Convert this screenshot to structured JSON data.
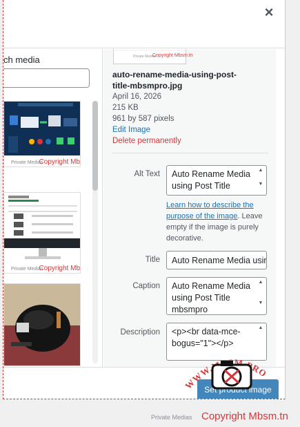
{
  "modal": {
    "close_label": "×"
  },
  "library": {
    "search_label": "ch media",
    "thumbnails": [
      {
        "type": "infographic",
        "watermark": "Private Medias",
        "copyright": "Copyright Mb"
      },
      {
        "type": "screenshot",
        "watermark": "Private Medias",
        "copyright": "Copyright Mb"
      },
      {
        "type": "photo"
      }
    ]
  },
  "details": {
    "filename": "auto-rename-media-using-post-title-mbsmpro.jpg",
    "date": "April 16, 2026",
    "size": "215 KB",
    "dimensions": "961 by 587 pixels",
    "edit_link": "Edit Image",
    "delete_link": "Delete permanently",
    "preview_caption": "Copyright Mbsm.tn",
    "preview_watermark": "Private Medias",
    "fields": {
      "alt_text": {
        "label": "Alt Text",
        "value": "Auto Rename Media using Post Title"
      },
      "help_link": "Learn how to describe the purpose of the image",
      "help_rest": ". Leave empty if the image is purely decorative.",
      "title": {
        "label": "Title",
        "value": "Auto Rename Media usin"
      },
      "caption": {
        "label": "Caption",
        "value": "Auto Rename Media using Post Title mbsmpro"
      },
      "description": {
        "label": "Description",
        "value": "<p><br data-mce-bogus=\"1\"></p>"
      }
    }
  },
  "footer": {
    "set_button": "Set product image"
  },
  "stamp": {
    "text": "WWW.MBSM.PRO"
  },
  "page_watermark": {
    "label": "Private Medias",
    "copyright": "Copyright Mbsm.tn"
  },
  "colors": {
    "accent": "#2271b1",
    "danger": "#d63638"
  }
}
